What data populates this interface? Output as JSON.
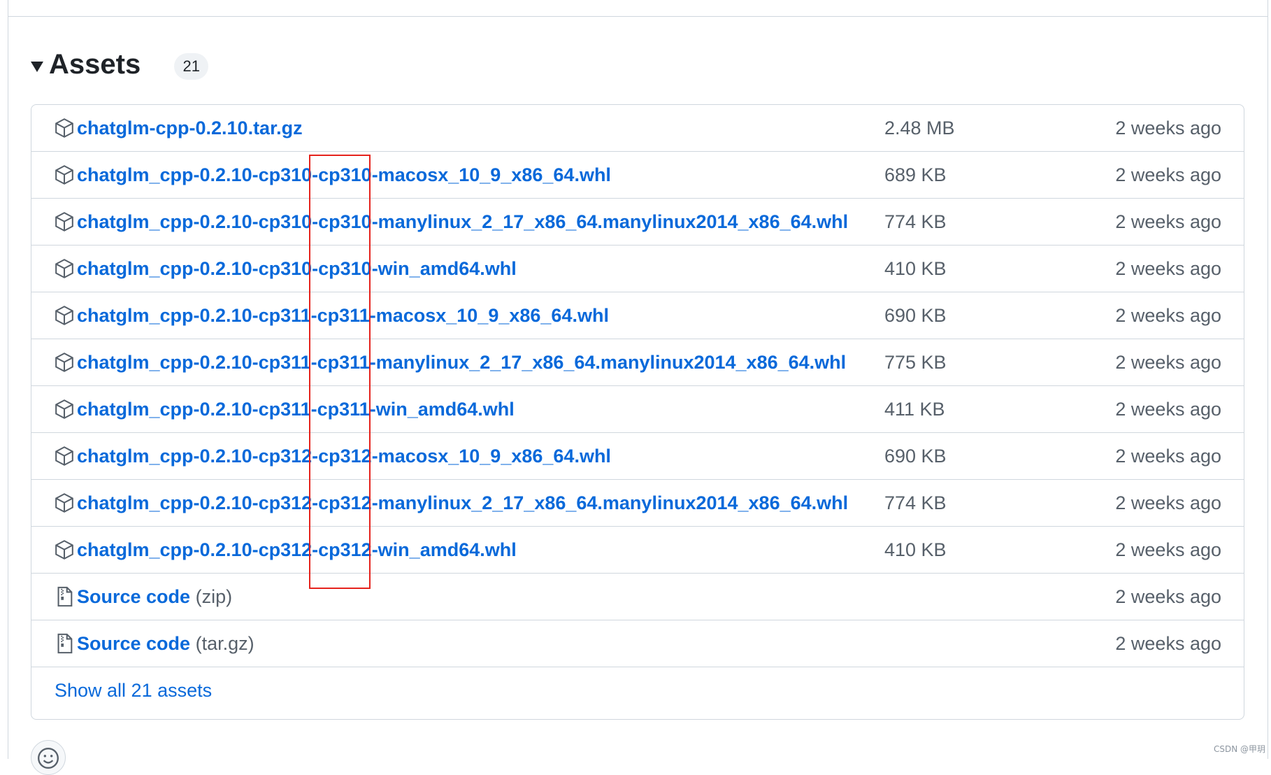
{
  "assets": {
    "title": "Assets",
    "count": "21",
    "items": [
      {
        "name": "chatglm-cpp-0.2.10.tar.gz",
        "size": "2.48 MB",
        "time": "2 weeks ago"
      },
      {
        "name": "chatglm_cpp-0.2.10-cp310-cp310-macosx_10_9_x86_64.whl",
        "size": "689 KB",
        "time": "2 weeks ago"
      },
      {
        "name": "chatglm_cpp-0.2.10-cp310-cp310-manylinux_2_17_x86_64.manylinux2014_x86_64.whl",
        "size": "774 KB",
        "time": "2 weeks ago"
      },
      {
        "name": "chatglm_cpp-0.2.10-cp310-cp310-win_amd64.whl",
        "size": "410 KB",
        "time": "2 weeks ago"
      },
      {
        "name": "chatglm_cpp-0.2.10-cp311-cp311-macosx_10_9_x86_64.whl",
        "size": "690 KB",
        "time": "2 weeks ago"
      },
      {
        "name": "chatglm_cpp-0.2.10-cp311-cp311-manylinux_2_17_x86_64.manylinux2014_x86_64.whl",
        "size": "775 KB",
        "time": "2 weeks ago"
      },
      {
        "name": "chatglm_cpp-0.2.10-cp311-cp311-win_amd64.whl",
        "size": "411 KB",
        "time": "2 weeks ago"
      },
      {
        "name": "chatglm_cpp-0.2.10-cp312-cp312-macosx_10_9_x86_64.whl",
        "size": "690 KB",
        "time": "2 weeks ago"
      },
      {
        "name": "chatglm_cpp-0.2.10-cp312-cp312-manylinux_2_17_x86_64.manylinux2014_x86_64.whl",
        "size": "774 KB",
        "time": "2 weeks ago"
      },
      {
        "name": "chatglm_cpp-0.2.10-cp312-cp312-win_amd64.whl",
        "size": "410 KB",
        "time": "2 weeks ago"
      }
    ],
    "source_code": [
      {
        "label": "Source code",
        "suffix": "(zip)",
        "time": "2 weeks ago"
      },
      {
        "label": "Source code",
        "suffix": "(tar.gz)",
        "time": "2 weeks ago"
      }
    ],
    "show_all_label": "Show all 21 assets"
  },
  "annotation": {
    "color": "#e5231d"
  },
  "colors": {
    "link": "#0969da",
    "muted": "#57606a",
    "border": "#d0d7de"
  },
  "icons": {
    "package": "package-icon",
    "file_zip": "file-zip-icon",
    "caret": "triangle-down-icon",
    "smiley": "smiley-icon"
  },
  "watermark": "CSDN @甲玥"
}
